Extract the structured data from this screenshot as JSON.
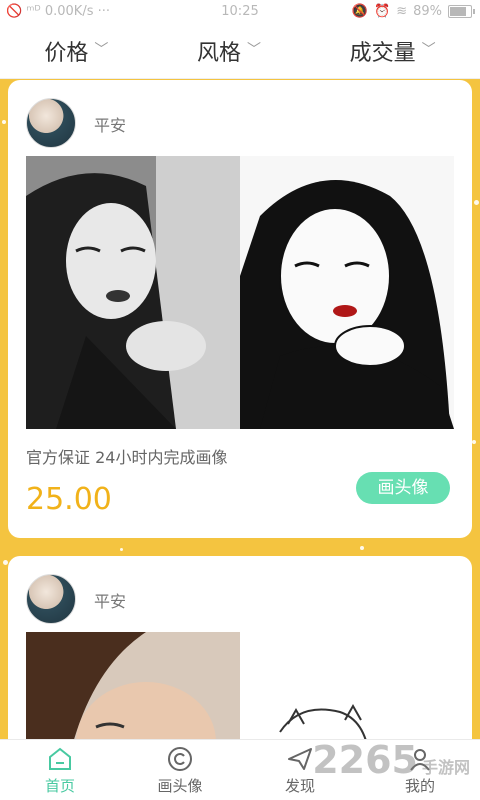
{
  "status_bar": {
    "left": "🚫 ᵐᴰ 0.00K/s ···",
    "time": "10:25",
    "battery": "89%",
    "battery_level": 0.89
  },
  "filters": [
    {
      "label": "价格"
    },
    {
      "label": "风格"
    },
    {
      "label": "成交量"
    }
  ],
  "cards": [
    {
      "username": "平安",
      "description": "官方保证 24小时内完成画像",
      "price": "25.00",
      "button": "画头像"
    },
    {
      "username": "平安"
    }
  ],
  "tabs": [
    {
      "label": "首页",
      "icon": "home-icon",
      "active": true
    },
    {
      "label": "画头像",
      "icon": "portrait-icon",
      "active": false
    },
    {
      "label": "发现",
      "icon": "paper-plane-icon",
      "active": false
    },
    {
      "label": "我的",
      "icon": "person-icon",
      "active": false
    }
  ],
  "watermark": {
    "text": "2265",
    "suffix": "手游网"
  },
  "colors": {
    "background": "#f4c440",
    "accent_green": "#48c9a1",
    "button_green": "#67dfb2",
    "price_gold": "#f1b21a"
  }
}
